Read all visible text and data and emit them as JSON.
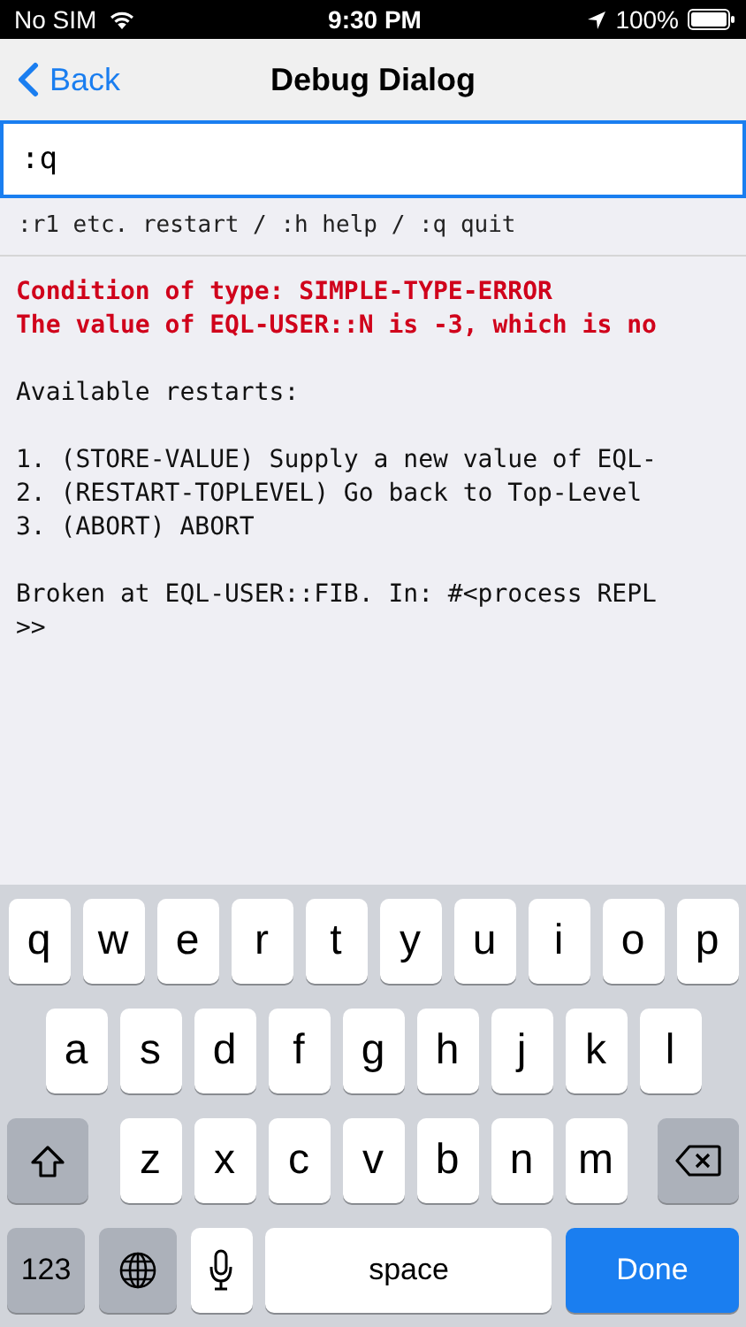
{
  "status_bar": {
    "carrier": "No SIM",
    "time": "9:30 PM",
    "battery": "100%"
  },
  "nav_bar": {
    "back": "Back",
    "title": "Debug Dialog"
  },
  "command_input": {
    "value": ":q"
  },
  "hint": ":r1 etc. restart / :h help / :q quit",
  "output": [
    {
      "kind": "error",
      "lines": [
        "Condition of type: SIMPLE-TYPE-ERROR",
        "The value of EQL-USER::N is -3, which is no"
      ]
    },
    {
      "kind": "normal",
      "lines": [
        "Available restarts:"
      ]
    },
    {
      "kind": "normal",
      "lines": [
        "1. (STORE-VALUE) Supply a new value of EQL-",
        "2. (RESTART-TOPLEVEL) Go back to Top-Level",
        "3. (ABORT) ABORT"
      ]
    },
    {
      "kind": "normal",
      "lines": [
        "Broken at EQL-USER::FIB. In: #<process REPL",
        ">>"
      ]
    }
  ],
  "keyboard": [
    [
      {
        "kind": "letter",
        "label": "q"
      },
      {
        "kind": "letter",
        "label": "w"
      },
      {
        "kind": "letter",
        "label": "e"
      },
      {
        "kind": "letter",
        "label": "r"
      },
      {
        "kind": "letter",
        "label": "t"
      },
      {
        "kind": "letter",
        "label": "y"
      },
      {
        "kind": "letter",
        "label": "u"
      },
      {
        "kind": "letter",
        "label": "i"
      },
      {
        "kind": "letter",
        "label": "o"
      },
      {
        "kind": "letter",
        "label": "p"
      }
    ],
    [
      {
        "kind": "letter",
        "label": "a"
      },
      {
        "kind": "letter",
        "label": "s"
      },
      {
        "kind": "letter",
        "label": "d"
      },
      {
        "kind": "letter",
        "label": "f"
      },
      {
        "kind": "letter",
        "label": "g"
      },
      {
        "kind": "letter",
        "label": "h"
      },
      {
        "kind": "letter",
        "label": "j"
      },
      {
        "kind": "letter",
        "label": "k"
      },
      {
        "kind": "letter",
        "label": "l"
      }
    ],
    [
      {
        "kind": "shift"
      },
      {
        "kind": "letter",
        "label": "z"
      },
      {
        "kind": "letter",
        "label": "x"
      },
      {
        "kind": "letter",
        "label": "c"
      },
      {
        "kind": "letter",
        "label": "v"
      },
      {
        "kind": "letter",
        "label": "b"
      },
      {
        "kind": "letter",
        "label": "n"
      },
      {
        "kind": "letter",
        "label": "m"
      },
      {
        "kind": "delete"
      }
    ],
    [
      {
        "kind": "numbers",
        "label": "123"
      },
      {
        "kind": "globe"
      },
      {
        "kind": "mic"
      },
      {
        "kind": "space",
        "label": "space"
      },
      {
        "kind": "done",
        "label": "Done"
      }
    ]
  ]
}
